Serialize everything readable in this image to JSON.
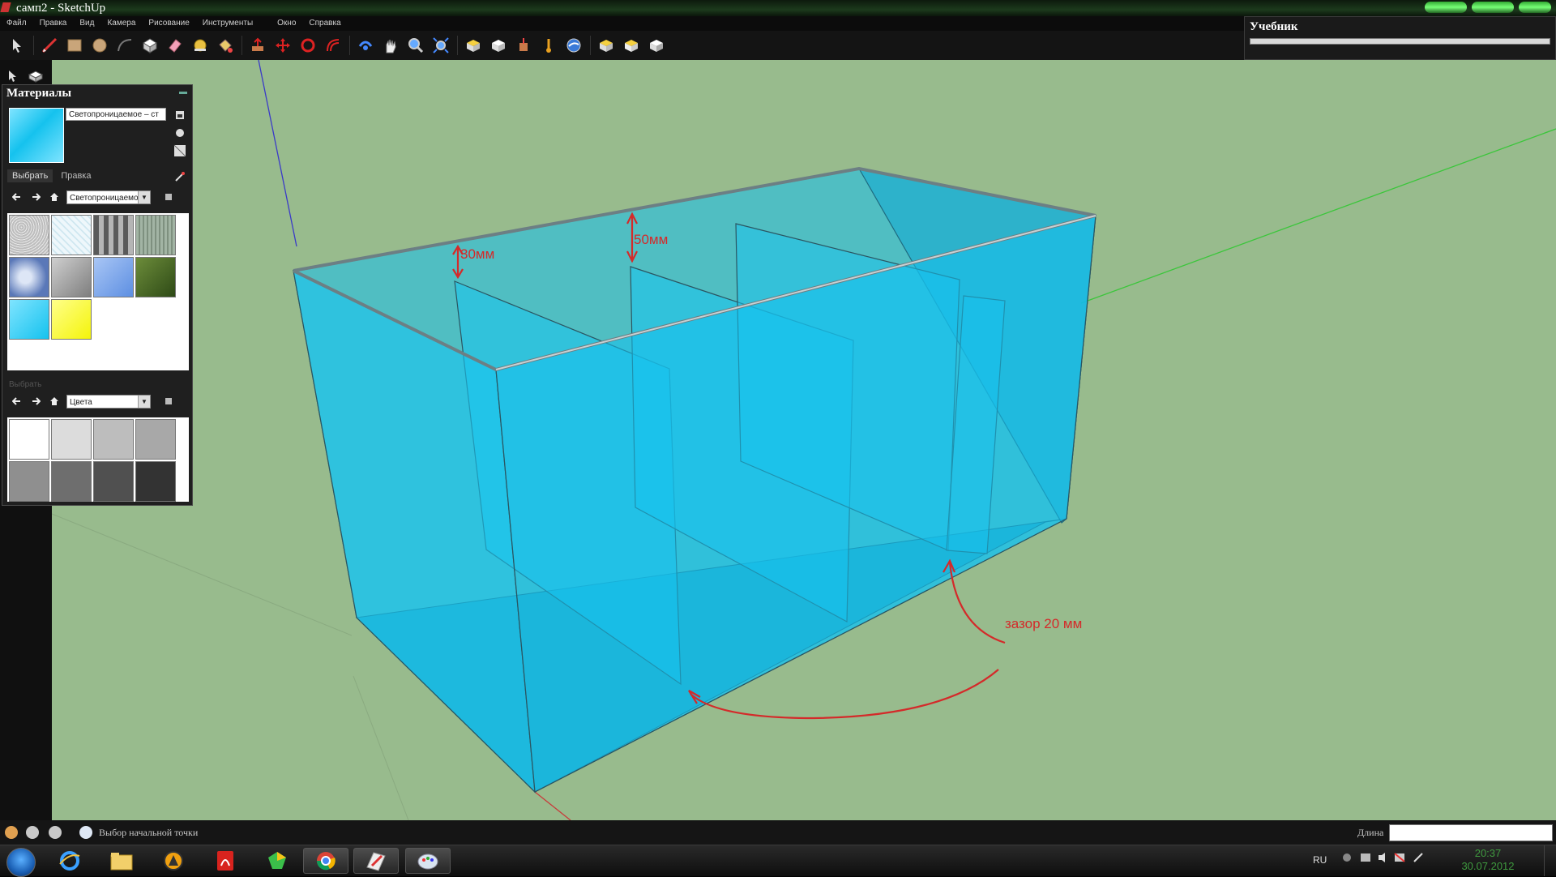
{
  "window": {
    "title": "самп2 - SketchUp"
  },
  "menu": [
    "Файл",
    "Правка",
    "Вид",
    "Камера",
    "Рисование",
    "Инструменты",
    "Окно",
    "Справка"
  ],
  "instructor": {
    "title": "Учебник"
  },
  "materials": {
    "title": "Материалы",
    "material_name": "Светопроницаемое – ст",
    "tabs": {
      "select": "Выбрать",
      "edit": "Правка"
    },
    "library": "Светопроницаемое",
    "secondary_label": "Выбрать",
    "secondary_library": "Цвета",
    "top_swatches": [
      "#d9d9d9",
      "#d6eef5",
      "#8a8a8a",
      "#96a898",
      "#5a78b8",
      "#9a9a9a",
      "#7aa3e6",
      "#4b6b2a",
      "#1cc3ee",
      "#ffff44"
    ],
    "color_swatches": [
      "#ffffff",
      "#dcdcdc",
      "#bdbdbd",
      "#a8a8a8",
      "#8f8f8f",
      "#6e6e6e",
      "#505050",
      "#333333"
    ]
  },
  "annotations": {
    "gap_30": "30мм",
    "gap_50": "50мм",
    "clearance": "зазор 20 мм"
  },
  "status": {
    "hint": "Выбор начальной точки",
    "length_label": "Длина"
  },
  "tray": {
    "lang": "RU",
    "time": "20:37",
    "date": "30.07.2012"
  },
  "colors": {
    "viewport": "#98bb8d",
    "glass": "#16c1ee",
    "annotation": "#d42a2a"
  }
}
